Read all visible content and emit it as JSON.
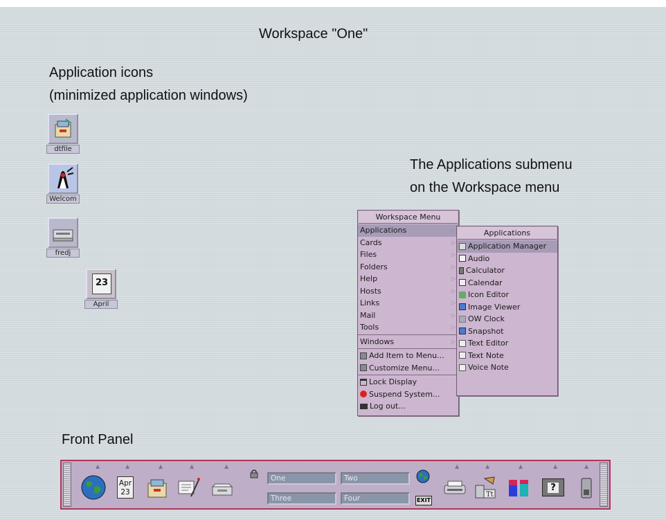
{
  "captions": {
    "workspace": "Workspace \"One\"",
    "app_icons_line1": "Application icons",
    "app_icons_line2": "(minimized application windows)",
    "submenu_line1": "The Applications submenu",
    "submenu_line2": "on the Workspace menu",
    "front_panel": "Front Panel"
  },
  "desktop_icons": [
    {
      "label": "dtfile",
      "icon": "file-manager-icon"
    },
    {
      "label": "Welcom",
      "icon": "welcome-duke-icon"
    },
    {
      "label": "fredj",
      "icon": "printer-tray-icon"
    },
    {
      "label": "April",
      "icon": "calendar-icon",
      "day": "23"
    }
  ],
  "workspace_menu": {
    "title": "Workspace Menu",
    "items": [
      "Applications",
      "Cards",
      "Files",
      "Folders",
      "Help",
      "Hosts",
      "Links",
      "Mail",
      "Tools",
      "Windows",
      "Add Item to Menu...",
      "Customize Menu...",
      "Lock Display",
      "Suspend System...",
      "Log out..."
    ]
  },
  "applications_menu": {
    "title": "Applications",
    "items": [
      "Application Manager",
      "Audio",
      "Calculator",
      "Calendar",
      "Icon Editor",
      "Image Viewer",
      "OW Clock",
      "Snapshot",
      "Text Editor",
      "Text Note",
      "Voice Note"
    ]
  },
  "front_panel": {
    "calendar_month": "Apr",
    "calendar_day": "23",
    "workspaces": [
      "One",
      "Two",
      "Three",
      "Four"
    ],
    "exit_label": "EXIT",
    "help_label": "?"
  },
  "colors": {
    "desktop": "#d5dde1",
    "menu": "#cdb6cf",
    "menu_highlight": "#a79cb7",
    "panel": "#bfaec7",
    "panel_border": "#b33458",
    "workspace_button": "#8b95a9"
  }
}
